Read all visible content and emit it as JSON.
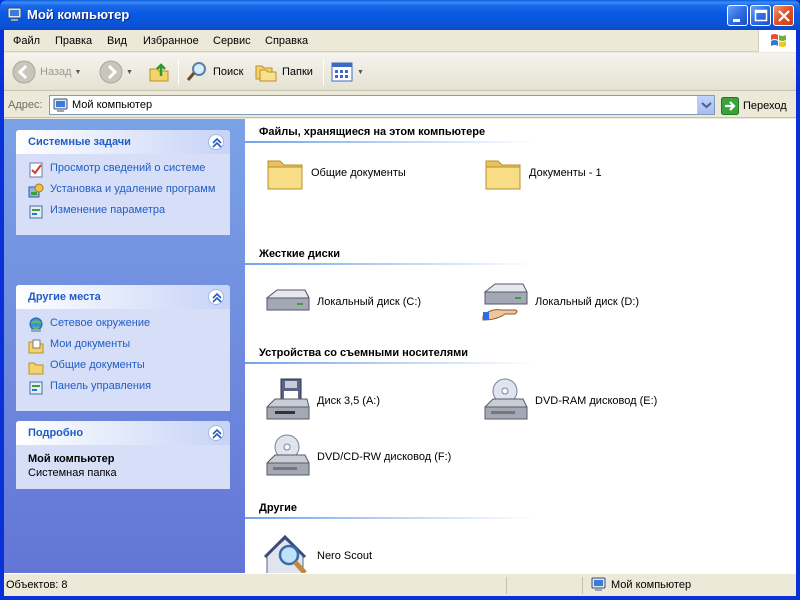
{
  "window": {
    "title": "Мой компьютер",
    "accent": "#0a54d8"
  },
  "menu": {
    "items": [
      "Файл",
      "Правка",
      "Вид",
      "Избранное",
      "Сервис",
      "Справка"
    ]
  },
  "toolbar": {
    "back_label": "Назад",
    "search_label": "Поиск",
    "folders_label": "Папки"
  },
  "address": {
    "label": "Адрес:",
    "value": "Мой компьютер",
    "go_label": "Переход"
  },
  "taskpane": {
    "system_tasks": {
      "title": "Системные задачи",
      "items": [
        {
          "label": "Просмотр сведений о системе",
          "icon": "system-info-icon"
        },
        {
          "label": "Установка и удаление программ",
          "icon": "add-remove-programs-icon"
        },
        {
          "label": "Изменение параметра",
          "icon": "control-panel-icon"
        }
      ]
    },
    "other_places": {
      "title": "Другие места",
      "items": [
        {
          "label": "Сетевое окружение",
          "icon": "network-icon"
        },
        {
          "label": "Мои документы",
          "icon": "my-documents-icon"
        },
        {
          "label": "Общие документы",
          "icon": "folder-icon"
        },
        {
          "label": "Панель управления",
          "icon": "control-panel-icon"
        }
      ]
    },
    "details": {
      "title": "Подробно",
      "name": "Мой компьютер",
      "type": "Системная папка"
    }
  },
  "content": {
    "groups": [
      {
        "title": "Файлы, хранящиеся на этом компьютере",
        "items": [
          {
            "label": "Общие документы",
            "icon": "folder-icon"
          },
          {
            "label": "Документы - 1",
            "icon": "folder-icon"
          }
        ]
      },
      {
        "title": "Жесткие диски",
        "items": [
          {
            "label": "Локальный диск (C:)",
            "icon": "hard-disk-icon"
          },
          {
            "label": "Локальный диск (D:)",
            "icon": "shared-hard-disk-icon"
          }
        ]
      },
      {
        "title": "Устройства со съемными носителями",
        "items": [
          {
            "label": "Диск 3,5 (A:)",
            "icon": "floppy-drive-icon"
          },
          {
            "label": "DVD-RAM дисковод (E:)",
            "icon": "dvd-drive-icon"
          },
          {
            "label": "DVD/CD-RW дисковод (F:)",
            "icon": "cd-drive-icon"
          }
        ]
      },
      {
        "title": "Другие",
        "items": [
          {
            "label": "Nero Scout",
            "icon": "nero-scout-icon"
          }
        ]
      }
    ]
  },
  "status": {
    "objects": "Объектов: 8",
    "location": "Мой компьютер"
  }
}
